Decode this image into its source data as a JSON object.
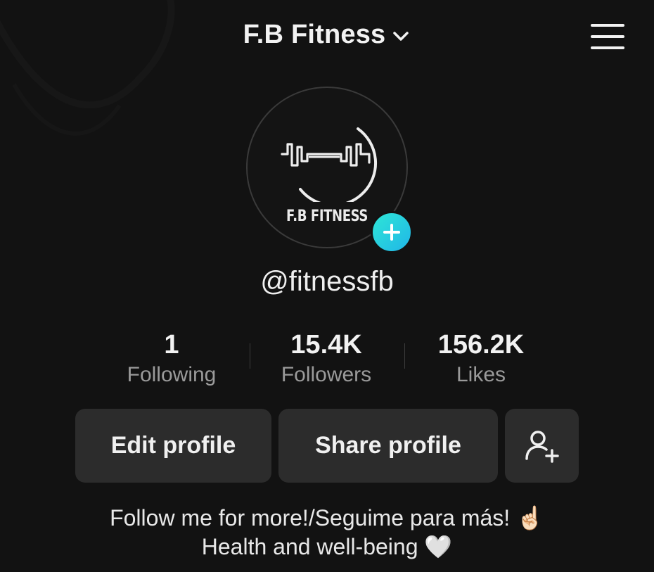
{
  "header": {
    "title": "F.B Fitness"
  },
  "avatar": {
    "label": "F.B FITNESS"
  },
  "profile": {
    "username": "@fitnessfb"
  },
  "stats": [
    {
      "value": "1",
      "label": "Following"
    },
    {
      "value": "15.4K",
      "label": "Followers"
    },
    {
      "value": "156.2K",
      "label": "Likes"
    }
  ],
  "actions": {
    "edit_label": "Edit profile",
    "share_label": "Share profile"
  },
  "bio": {
    "line1": "Follow me for more!/Seguime para más! ☝🏻",
    "line2": "Health and well-being 🤍"
  },
  "colors": {
    "background": "#121212",
    "button_bg": "#2c2c2c",
    "accent_gradient_start": "#2ee6d6",
    "accent_gradient_end": "#20b6e8",
    "muted_text": "#9a9a9a"
  },
  "icons": {
    "dropdown": "chevron-down-icon",
    "menu": "hamburger-menu-icon",
    "add_avatar": "plus-icon",
    "add_friend": "person-plus-icon",
    "logo": "barbell-heartbeat-logo"
  }
}
